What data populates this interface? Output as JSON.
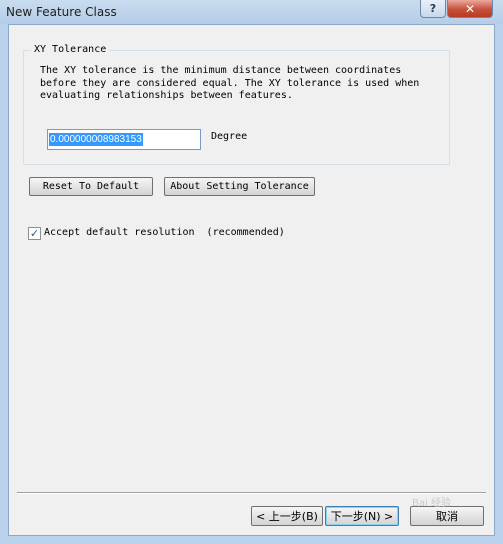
{
  "window": {
    "title": "New Feature Class",
    "help_label": "?",
    "close_label": "✕"
  },
  "xy_tolerance": {
    "group_title": "XY Tolerance",
    "description": "The XY tolerance is the minimum distance between coordinates\nbefore they are considered equal. The XY tolerance is used when\nevaluating relationships between features.",
    "value": "0.000000008983153",
    "unit": "Degree"
  },
  "buttons": {
    "reset": "Reset To Default",
    "about": "About Setting Tolerance"
  },
  "resolution": {
    "checked": true,
    "label": "Accept default resolution  (recommended)",
    "check_mark": "✓"
  },
  "footer": {
    "back": "< 上一步(B)",
    "next": "下一步(N) >",
    "cancel": "取消"
  },
  "watermark": "Bai 经验"
}
